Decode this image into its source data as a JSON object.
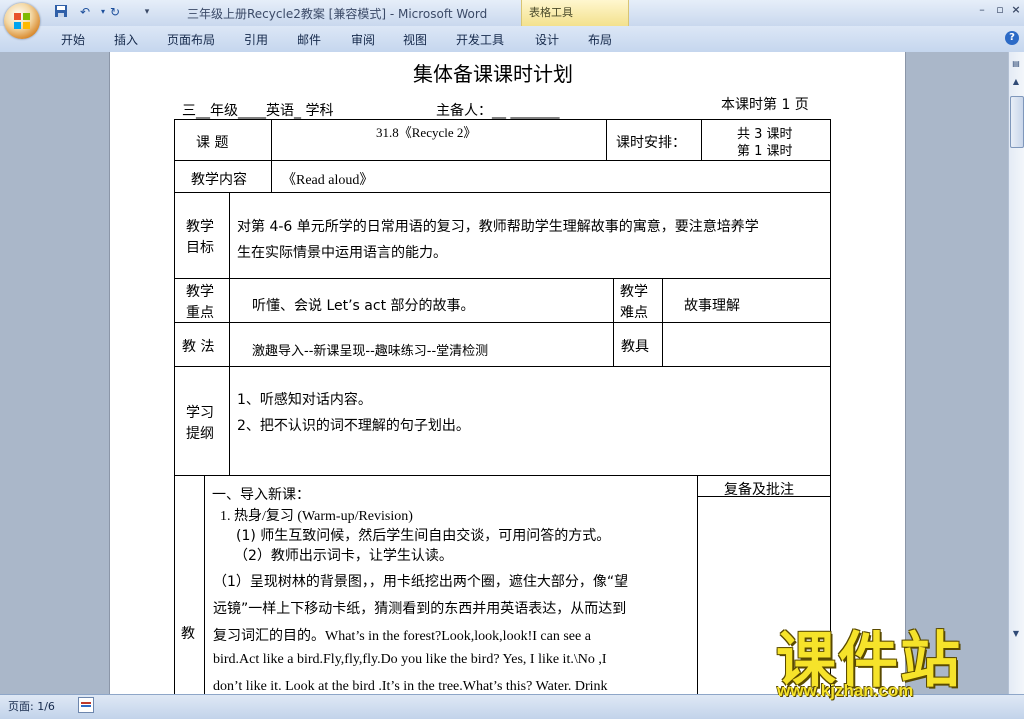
{
  "window": {
    "title": "三年级上册Recycle2教案 [兼容模式] - Microsoft Word",
    "context_tab": "表格工具",
    "controls": [
      "–",
      "▫"
    ]
  },
  "quick_access": [
    "save-icon",
    "undo-icon",
    "redo-icon",
    "customize-icon"
  ],
  "ribbon_tabs": [
    "开始",
    "插入",
    "页面布局",
    "引用",
    "邮件",
    "审阅",
    "视图",
    "开发工具",
    "设计",
    "布局"
  ],
  "status": {
    "page": "页面: 1/6"
  },
  "document": {
    "heading": "集体备课课时计划",
    "meta_left": "三__年级____英语_ 学科",
    "meta_mid": "主备人：__ _______",
    "meta_right": "本课时第 1 页",
    "row1": {
      "label": "课    题",
      "value": "31.8《Recycle 2》",
      "sched_label": "课时安排：",
      "sched_total": "共 3 课时",
      "sched_current": "第 1 课时"
    },
    "row2": {
      "label": "教学内容",
      "value": "《Read        aloud》"
    },
    "row3": {
      "label1": "教学",
      "label2": "目标",
      "line1": "对第 4-6 单元所学的日常用语的复习，教师帮助学生理解故事的寓意，要注意培养学",
      "line2": "生在实际情景中运用语言的能力。"
    },
    "row4": {
      "label1": "教学",
      "label2": "重点",
      "value": "听懂、会说 Let’s act 部分的故事。",
      "hard1": "教学",
      "hard2": "难点",
      "hard_value": "故事理解"
    },
    "row5": {
      "label": "教 法",
      "value": "激趣导入--新课呈现--趣味练习--堂清检测",
      "tools_label": "教具"
    },
    "row6": {
      "label1": "学习",
      "label2": "提纲",
      "item1": "1、听感知对话内容。",
      "item2": "2、把不认识的词不理解的句子划出。"
    },
    "row7": {
      "side_label": "教",
      "review_label": "复备及批注",
      "lines": [
        "一、导入新课：",
        "1.    热身/复习  (Warm-up/Revision)",
        "(1) 师生互致问候，然后学生间自由交谈，可用问答的方式。",
        "（2）教师出示词卡，让学生认读。",
        "（1）呈现树林的背景图，，用卡纸挖出两个圈，遮住大部分，像“望",
        "远镜”一样上下移动卡纸，猜测看到的东西并用英语表达，从而达到",
        "复习词汇的目的。What’s  in  the  forest?Look,look,look!I  can  see  a",
        "bird.Act like a bird.Fly,fly,fly.Do you like the bird? Yes, I like it.\\No ,I",
        "don’t like it. Look at the bird .It’s in the tree.What’s this? Water. Drink"
      ]
    }
  },
  "watermark": {
    "main": "课件站",
    "url": "www.kjzhan.com"
  }
}
